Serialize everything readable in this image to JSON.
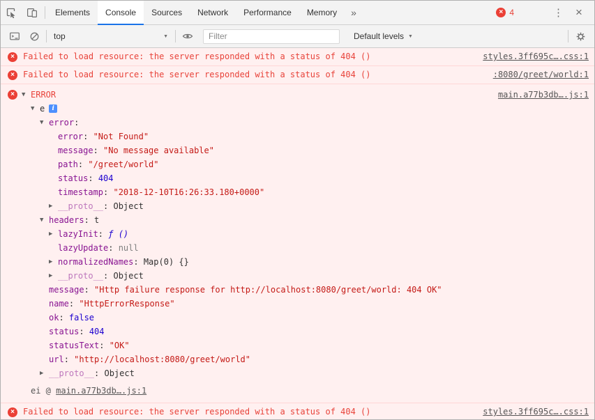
{
  "colors": {
    "toolbar_bg": "#f3f3f3",
    "active_tab_accent": "#1a73e8",
    "error_text": "#e8433a",
    "error_row_bg": "#fff0f0",
    "error_row_border": "#ffd6d6",
    "key_purple": "#881391",
    "string_red": "#c41a16",
    "number_blue": "#1c00cf",
    "link_gray": "#565656"
  },
  "icons": {
    "error_x": "×",
    "kebab": "⋮",
    "close": "×",
    "overflow_tabs": "»",
    "caret_down": "▼",
    "expander_open": "▼",
    "expander_closed": "▶",
    "info": "i"
  },
  "tabbar": {
    "tabs": [
      {
        "label": "Elements",
        "active": false
      },
      {
        "label": "Console",
        "active": true
      },
      {
        "label": "Sources",
        "active": false
      },
      {
        "label": "Network",
        "active": false
      },
      {
        "label": "Performance",
        "active": false
      },
      {
        "label": "Memory",
        "active": false
      }
    ],
    "error_count": "4"
  },
  "toolbar": {
    "context": "top",
    "filter_placeholder": "Filter",
    "levels_label": "Default levels"
  },
  "console": {
    "messages": [
      {
        "type": "error",
        "text": "Failed to load resource: the server responded with a status of 404 ()",
        "source": "styles.3ff695c….css:1"
      },
      {
        "type": "error",
        "text": "Failed to load resource: the server responded with a status of 404 ()",
        "source": ":8080/greet/world:1"
      },
      {
        "type": "error-object",
        "source": "main.a77b3db….js:1",
        "rows": [
          {
            "indent": 0,
            "exp": "open",
            "segs": [
              {
                "t": "ERROR",
                "c": "err"
              }
            ],
            "link": "main.a77b3db….js:1"
          },
          {
            "indent": 1,
            "exp": "open",
            "segs": [
              {
                "t": "e",
                "c": "plain"
              }
            ],
            "info": true
          },
          {
            "indent": 2,
            "exp": "open",
            "segs": [
              {
                "t": "error",
                "c": "key"
              },
              {
                "t": ":",
                "c": "plain"
              }
            ]
          },
          {
            "indent": 3,
            "segs": [
              {
                "t": "error",
                "c": "key"
              },
              {
                "t": ": ",
                "c": "plain"
              },
              {
                "t": "\"Not Found\"",
                "c": "str"
              }
            ]
          },
          {
            "indent": 3,
            "segs": [
              {
                "t": "message",
                "c": "key"
              },
              {
                "t": ": ",
                "c": "plain"
              },
              {
                "t": "\"No message available\"",
                "c": "str"
              }
            ]
          },
          {
            "indent": 3,
            "segs": [
              {
                "t": "path",
                "c": "key"
              },
              {
                "t": ": ",
                "c": "plain"
              },
              {
                "t": "\"/greet/world\"",
                "c": "str"
              }
            ]
          },
          {
            "indent": 3,
            "segs": [
              {
                "t": "status",
                "c": "key"
              },
              {
                "t": ": ",
                "c": "plain"
              },
              {
                "t": "404",
                "c": "num"
              }
            ]
          },
          {
            "indent": 3,
            "segs": [
              {
                "t": "timestamp",
                "c": "key"
              },
              {
                "t": ": ",
                "c": "plain"
              },
              {
                "t": "\"2018-12-10T16:26:33.180+0000\"",
                "c": "str"
              }
            ]
          },
          {
            "indent": 3,
            "exp": "closed",
            "segs": [
              {
                "t": "__proto__",
                "c": "keym"
              },
              {
                "t": ": ",
                "c": "plain"
              },
              {
                "t": "Object",
                "c": "plain"
              }
            ]
          },
          {
            "indent": 2,
            "exp": "open",
            "segs": [
              {
                "t": "headers",
                "c": "key"
              },
              {
                "t": ": ",
                "c": "plain"
              },
              {
                "t": "t",
                "c": "plain"
              }
            ]
          },
          {
            "indent": 3,
            "exp": "closed",
            "segs": [
              {
                "t": "lazyInit",
                "c": "key"
              },
              {
                "t": ": ",
                "c": "plain"
              },
              {
                "t": "ƒ ()",
                "c": "fn"
              }
            ]
          },
          {
            "indent": 3,
            "segs": [
              {
                "t": "lazyUpdate",
                "c": "key"
              },
              {
                "t": ": ",
                "c": "plain"
              },
              {
                "t": "null",
                "c": "null"
              }
            ]
          },
          {
            "indent": 3,
            "exp": "closed",
            "segs": [
              {
                "t": "normalizedNames",
                "c": "key"
              },
              {
                "t": ": ",
                "c": "plain"
              },
              {
                "t": "Map(0) {}",
                "c": "plain"
              }
            ]
          },
          {
            "indent": 3,
            "exp": "closed",
            "segs": [
              {
                "t": "__proto__",
                "c": "keym"
              },
              {
                "t": ": ",
                "c": "plain"
              },
              {
                "t": "Object",
                "c": "plain"
              }
            ]
          },
          {
            "indent": 2,
            "segs": [
              {
                "t": "message",
                "c": "key"
              },
              {
                "t": ": ",
                "c": "plain"
              },
              {
                "t": "\"Http failure response for http://localhost:8080/greet/world: 404 OK\"",
                "c": "str"
              }
            ]
          },
          {
            "indent": 2,
            "segs": [
              {
                "t": "name",
                "c": "key"
              },
              {
                "t": ": ",
                "c": "plain"
              },
              {
                "t": "\"HttpErrorResponse\"",
                "c": "str"
              }
            ]
          },
          {
            "indent": 2,
            "segs": [
              {
                "t": "ok",
                "c": "key"
              },
              {
                "t": ": ",
                "c": "plain"
              },
              {
                "t": "false",
                "c": "bool"
              }
            ]
          },
          {
            "indent": 2,
            "segs": [
              {
                "t": "status",
                "c": "key"
              },
              {
                "t": ": ",
                "c": "plain"
              },
              {
                "t": "404",
                "c": "num"
              }
            ]
          },
          {
            "indent": 2,
            "segs": [
              {
                "t": "statusText",
                "c": "key"
              },
              {
                "t": ": ",
                "c": "plain"
              },
              {
                "t": "\"OK\"",
                "c": "str"
              }
            ]
          },
          {
            "indent": 2,
            "segs": [
              {
                "t": "url",
                "c": "key"
              },
              {
                "t": ": ",
                "c": "plain"
              },
              {
                "t": "\"http://localhost:8080/greet/world\"",
                "c": "str"
              }
            ]
          },
          {
            "indent": 2,
            "exp": "closed",
            "segs": [
              {
                "t": "__proto__",
                "c": "keym"
              },
              {
                "t": ": ",
                "c": "plain"
              },
              {
                "t": "Object",
                "c": "plain"
              }
            ]
          }
        ],
        "stack": {
          "prefix": "ei @ ",
          "source": "main.a77b3db….js:1"
        }
      },
      {
        "type": "error",
        "text": "Failed to load resource: the server responded with a status of 404 ()",
        "source": "styles.3ff695c….css:1"
      }
    ]
  }
}
